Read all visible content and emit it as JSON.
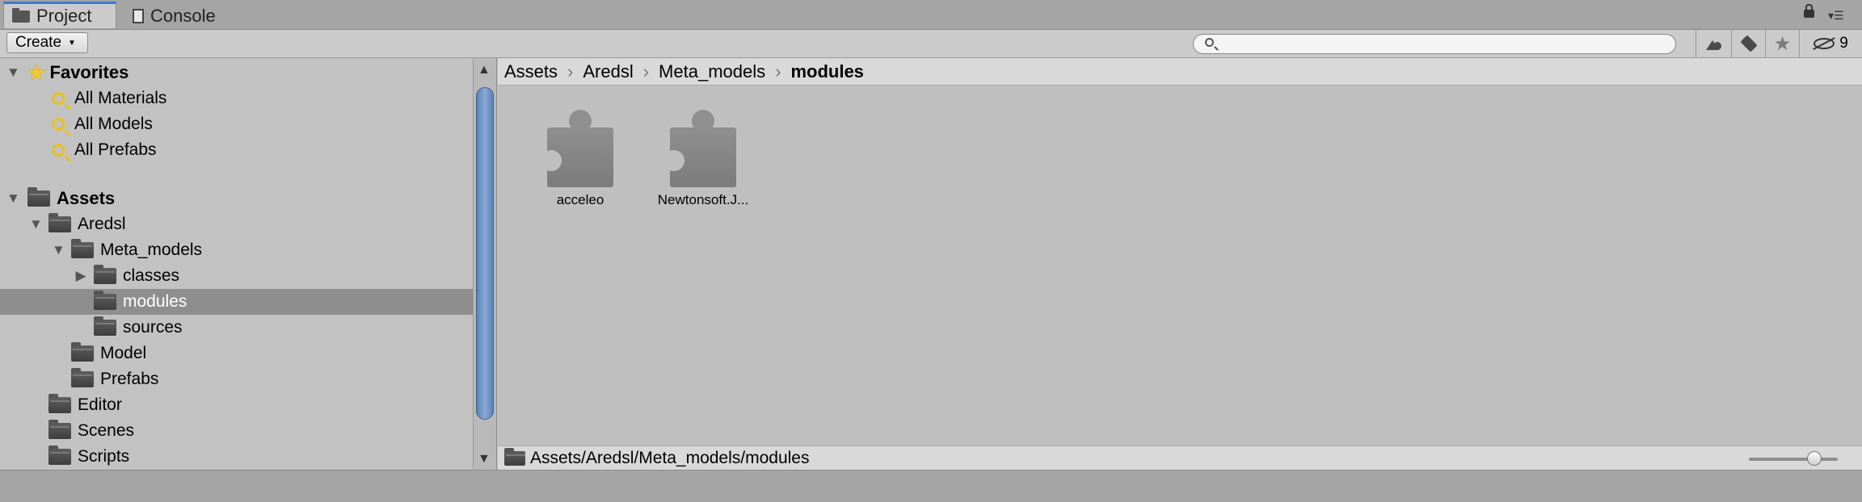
{
  "tabs": [
    {
      "label": "Project",
      "icon": "folder-icon",
      "active": true
    },
    {
      "label": "Console",
      "icon": "console-icon",
      "active": false
    }
  ],
  "toolbar": {
    "create_label": "Create",
    "search_placeholder": "",
    "hidden_count": "9"
  },
  "tree": {
    "favorites": {
      "label": "Favorites",
      "items": [
        "All Materials",
        "All Models",
        "All Prefabs"
      ]
    },
    "assets": {
      "label": "Assets",
      "items": [
        {
          "label": "Aredsl",
          "depth": 1,
          "expanded": true
        },
        {
          "label": "Meta_models",
          "depth": 2,
          "expanded": true
        },
        {
          "label": "classes",
          "depth": 3,
          "expanded": false
        },
        {
          "label": "modules",
          "depth": 3,
          "selected": true
        },
        {
          "label": "sources",
          "depth": 3
        },
        {
          "label": "Model",
          "depth": 2
        },
        {
          "label": "Prefabs",
          "depth": 2
        },
        {
          "label": "Editor",
          "depth": 1
        },
        {
          "label": "Scenes",
          "depth": 1
        },
        {
          "label": "Scripts",
          "depth": 1
        }
      ]
    }
  },
  "breadcrumb": [
    "Assets",
    "Aredsl",
    "Meta_models",
    "modules"
  ],
  "assets_grid": [
    {
      "label": "acceleo",
      "icon": "puzzle-icon"
    },
    {
      "label": "Newtonsoft.J...",
      "icon": "puzzle-icon"
    }
  ],
  "path": "Assets/Aredsl/Meta_models/modules",
  "colors": {
    "selection": "#8e8e8e",
    "active_tab_accent": "#3c7bd4",
    "scroll_thumb": "#6f93c6"
  }
}
